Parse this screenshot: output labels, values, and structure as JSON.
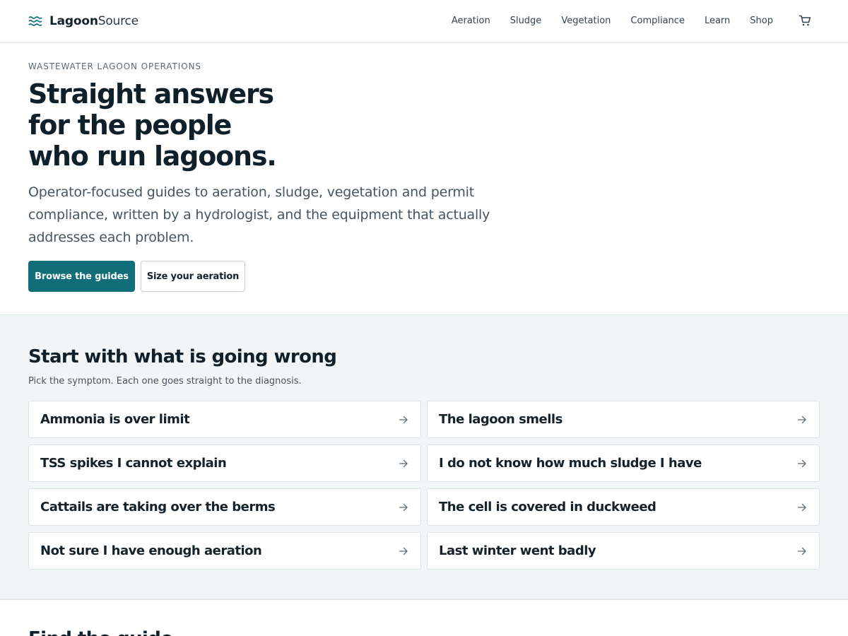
{
  "brand": {
    "name_bold": "Lagoon",
    "name_light": "Source",
    "accent": "#106e78",
    "logo_icon": "waves-icon"
  },
  "nav": {
    "items": [
      {
        "label": "Aeration"
      },
      {
        "label": "Sludge"
      },
      {
        "label": "Vegetation"
      },
      {
        "label": "Compliance"
      },
      {
        "label": "Learn"
      },
      {
        "label": "Shop"
      }
    ],
    "cart_icon": "cart-icon"
  },
  "hero": {
    "eyebrow": "WASTEWATER LAGOON OPERATIONS",
    "title": "Straight answers\nfor the people\nwho run lagoons.",
    "subtitle": "Operator-focused guides to aeration, sludge, vegetation and permit compliance, written by a hydrologist, and the equipment that actually addresses each problem.",
    "primary_button": "Browse the guides",
    "secondary_button": "Size your aeration"
  },
  "symptoms": {
    "title": "Start with what is going wrong",
    "subtitle": "Pick the symptom. Each one goes straight to the diagnosis.",
    "items": [
      {
        "label": "Ammonia is over limit"
      },
      {
        "label": "The lagoon smells"
      },
      {
        "label": "TSS spikes I cannot explain"
      },
      {
        "label": "I do not know how much sludge I have"
      },
      {
        "label": "Cattails are taking over the berms"
      },
      {
        "label": "The cell is covered in duckweed"
      },
      {
        "label": "Not sure I have enough aeration"
      },
      {
        "label": "Last winter went badly"
      }
    ],
    "arrow_icon": "arrow-right-icon"
  },
  "next_section": {
    "title": "Find the guide"
  }
}
